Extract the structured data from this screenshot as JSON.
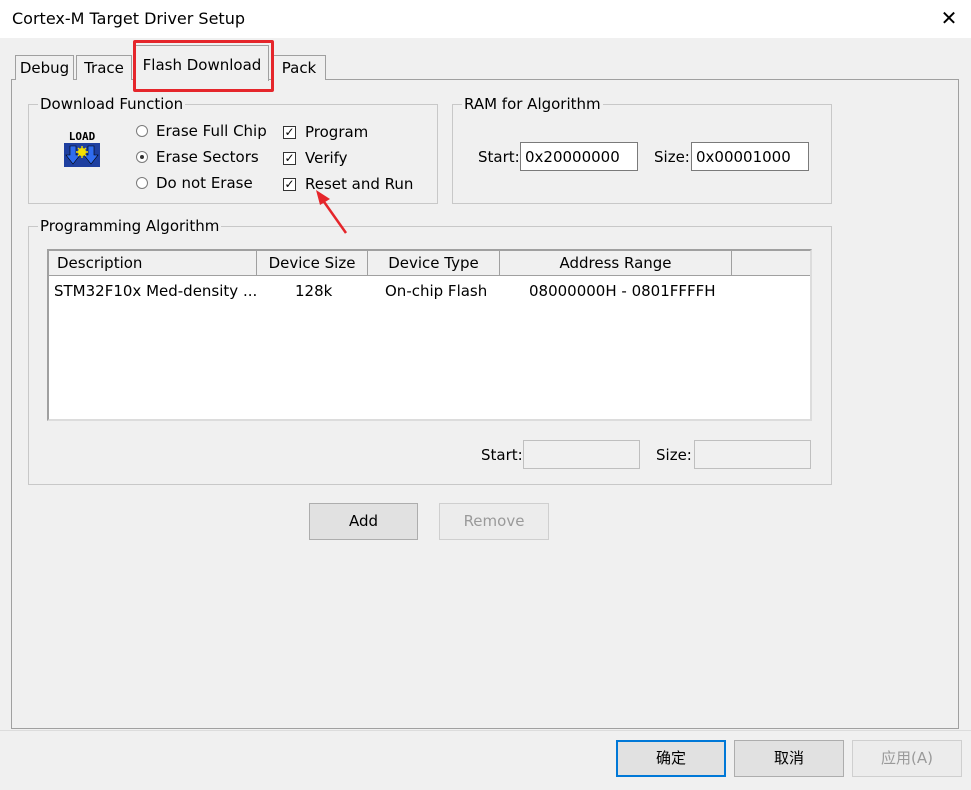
{
  "window": {
    "title": "Cortex-M Target Driver Setup",
    "close_glyph": "✕"
  },
  "tabs": [
    {
      "label": "Debug"
    },
    {
      "label": "Trace"
    },
    {
      "label": "Flash Download",
      "active": true
    },
    {
      "label": "Pack"
    }
  ],
  "download_function": {
    "legend": "Download Function",
    "load_icon_text": "LOAD",
    "radios": [
      {
        "label": "Erase Full Chip",
        "selected": false
      },
      {
        "label": "Erase Sectors",
        "selected": true
      },
      {
        "label": "Do not Erase",
        "selected": false
      }
    ],
    "checks": [
      {
        "label": "Program",
        "checked": true
      },
      {
        "label": "Verify",
        "checked": true
      },
      {
        "label": "Reset and Run",
        "checked": true
      }
    ]
  },
  "ram_for_algorithm": {
    "legend": "RAM for Algorithm",
    "start_label": "Start:",
    "start_value": "0x20000000",
    "size_label": "Size:",
    "size_value": "0x00001000"
  },
  "programming_algorithm": {
    "legend": "Programming Algorithm",
    "columns": [
      "Description",
      "Device Size",
      "Device Type",
      "Address Range"
    ],
    "rows": [
      {
        "description": "STM32F10x Med-density ...",
        "device_size": "128k",
        "device_type": "On-chip Flash",
        "address_range": "08000000H - 0801FFFFH"
      }
    ],
    "start_label": "Start:",
    "start_value": "",
    "size_label": "Size:",
    "size_value": ""
  },
  "buttons": {
    "add": "Add",
    "remove": "Remove"
  },
  "footer": {
    "ok": "确定",
    "cancel": "取消",
    "apply": "应用(A)"
  },
  "annotation": {
    "highlight_color": "#e5262b"
  }
}
